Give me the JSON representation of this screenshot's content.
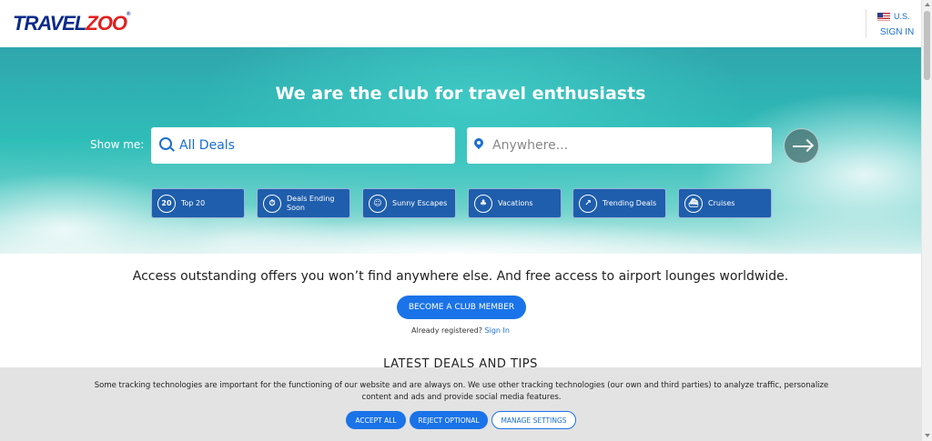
{
  "header": {
    "logo_main": "TRAVEL",
    "logo_accent": "ZOO",
    "logo_mark": "®",
    "region": "U.S.",
    "sign_in": "SIGN IN"
  },
  "hero": {
    "title": "We are the club for travel enthusiasts",
    "show_me": "Show me:",
    "deals_value": "All Deals",
    "destination_placeholder": "Anywhere...",
    "categories": [
      {
        "label": "Top 20",
        "icon": "top-20-icon"
      },
      {
        "label": "Deals Ending Soon",
        "icon": "clock-icon"
      },
      {
        "label": "Sunny Escapes",
        "icon": "people-icon"
      },
      {
        "label": "Vacations",
        "icon": "palm-tree-icon"
      },
      {
        "label": "Trending Deals",
        "icon": "trending-icon"
      },
      {
        "label": "Cruises",
        "icon": "ship-icon"
      }
    ]
  },
  "main": {
    "tagline": "Access outstanding offers you won’t find anywhere else. And free access to airport lounges worldwide.",
    "member_button": "BECOME A CLUB MEMBER",
    "already_registered": "Already registered?",
    "sign_in_link": "Sign In",
    "latest_heading": "LATEST DEALS AND TIPS"
  },
  "cookie": {
    "text": "Some tracking technologies are important for the functioning of our website and are always on. We use other tracking technologies (our own and third parties) to analyze traffic, personalize content and ads and provide social media features.",
    "accept_all": "ACCEPT ALL",
    "reject_optional": "REJECT OPTIONAL",
    "manage_settings": "MANAGE SETTINGS"
  },
  "colors": {
    "brand_blue": "#1a73e8",
    "category_blue": "#1f5eac",
    "logo_red": "#e02020"
  }
}
